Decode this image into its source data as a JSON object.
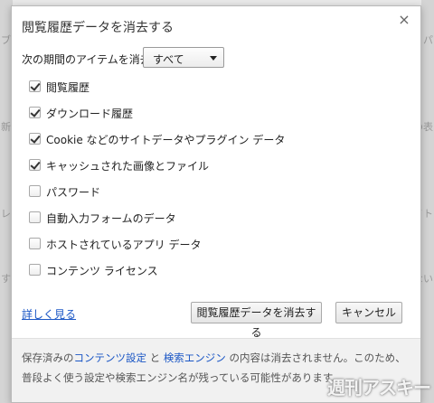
{
  "background": {
    "left_fragments": [
      "ブ",
      "新",
      "レ",
      "す"
    ],
    "right_fragments": [
      "パ",
      "ンの表",
      "イト",
      "ない"
    ]
  },
  "dialog": {
    "title": "閲覧履歴データを消去する",
    "close_glyph": "×"
  },
  "period": {
    "label": "次の期間のアイテムを消去:",
    "selected": "すべて"
  },
  "options": [
    {
      "label": "閲覧履歴",
      "checked": true
    },
    {
      "label": "ダウンロード履歴",
      "checked": true
    },
    {
      "label": "Cookie などのサイトデータやプラグイン データ",
      "checked": true
    },
    {
      "label": "キャッシュされた画像とファイル",
      "checked": true
    },
    {
      "label": "パスワード",
      "checked": false
    },
    {
      "label": "自動入力フォームのデータ",
      "checked": false
    },
    {
      "label": "ホストされているアプリ データ",
      "checked": false
    },
    {
      "label": "コンテンツ ライセンス",
      "checked": false
    }
  ],
  "details_link": "詳しく見る",
  "buttons": {
    "clear": "閲覧履歴データを消去する",
    "cancel": "キャンセル"
  },
  "footer": {
    "text_1": "保存済みの",
    "link_1": "コンテンツ設定",
    "text_2": "と",
    "link_2": "検索エンジン",
    "text_3": "の内容は消去されません。このため、普段よく使う設定や検索エンジン名が残っている可能性があります。"
  },
  "watermark": "週刊アスキー",
  "colors": {
    "link": "#1a56c5",
    "footer_bg": "#f1f1f1"
  }
}
